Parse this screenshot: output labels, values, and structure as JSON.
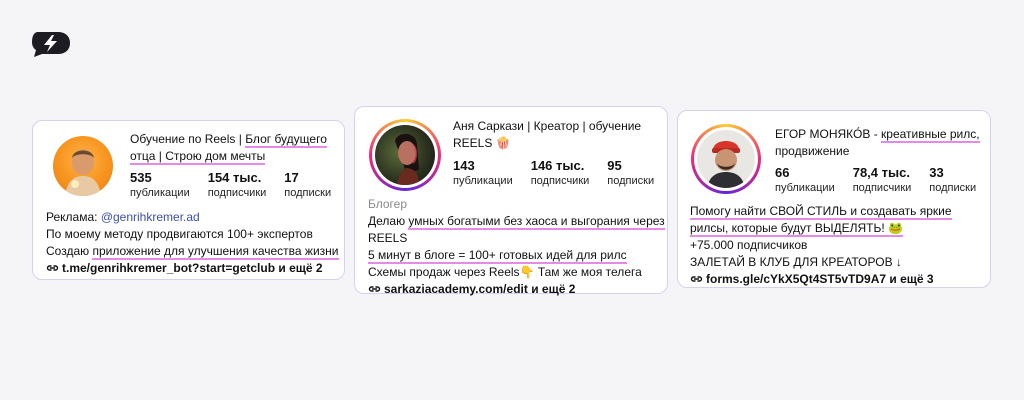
{
  "card1": {
    "name_plain": "Обучение по Reels | ",
    "name_hl1": "Блог будущего",
    "name_hl2": "отца | Строю дом мечты",
    "stats": [
      {
        "num": "535",
        "label": "публикации"
      },
      {
        "num": "154 тыс.",
        "label": "подписчики"
      },
      {
        "num": "17",
        "label": "подписки"
      }
    ],
    "ad_label": "Реклама: ",
    "ad_handle": "@genrihkremer.ad",
    "bio_line1": "По моему методу продвигаются 100+ экспертов",
    "bio_line2_plain": "Создаю ",
    "bio_line2_hl": "приложение для улучшения качества жизни",
    "link": "t.me/genrihkremer_bot?start=getclub и ещё 2"
  },
  "card2": {
    "name_line1": "Аня Саркази | Креатор | обучение",
    "name_line2": "REELS 🍿",
    "stats": [
      {
        "num": "143",
        "label": "публикации"
      },
      {
        "num": "146 тыс.",
        "label": "подписчики"
      },
      {
        "num": "95",
        "label": "подписки"
      }
    ],
    "category": "Блогер",
    "bio_line1_plain": "Делаю ",
    "bio_line1_hl": "умных богатыми без хаоса и выгорания через",
    "bio_line2": "REELS",
    "bio_line3_hl": "5 минут в блоге = 100+ готовых идей для рилс",
    "bio_line4": "Схемы продаж через Reels👇 Там же моя телега",
    "link": "sarkaziacademy.com/edit и ещё 2"
  },
  "card3": {
    "name_plain": "ЕГОР МОНЯКО́В - ",
    "name_hl": "креативные рилс,",
    "name_line2": "продвижение",
    "stats": [
      {
        "num": "66",
        "label": "публикации"
      },
      {
        "num": "78,4 тыс.",
        "label": "подписчики"
      },
      {
        "num": "33",
        "label": "подписки"
      }
    ],
    "bio_line1_hl": "Помогу найти СВОЙ СТИЛЬ и создавать яркие",
    "bio_line2_hl": "рилсы, которые будут ВЫДЕЛЯТЬ! 🐸",
    "bio_line3": "+75.000 подписчиков",
    "bio_line4": "ЗАЛЕТАЙ В КЛУБ ДЛЯ КРЕАТОРОВ ↓",
    "link": "forms.gle/cYkX5Qt4ST5vTD9A7 и ещё 3"
  }
}
